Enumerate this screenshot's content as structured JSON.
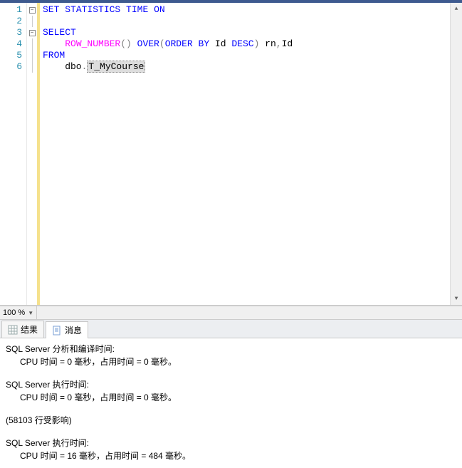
{
  "editor": {
    "lines": [
      {
        "n": 1,
        "fold": "minus",
        "tokens": [
          {
            "t": "SET",
            "c": "kw"
          },
          {
            "t": " ",
            "c": "txt"
          },
          {
            "t": "STATISTICS",
            "c": "kw"
          },
          {
            "t": " ",
            "c": "txt"
          },
          {
            "t": "TIME",
            "c": "kw"
          },
          {
            "t": " ",
            "c": "txt"
          },
          {
            "t": "ON",
            "c": "kw"
          }
        ]
      },
      {
        "n": 2,
        "fold": "line",
        "tokens": []
      },
      {
        "n": 3,
        "fold": "minus",
        "tokens": [
          {
            "t": "SELECT",
            "c": "kw"
          }
        ]
      },
      {
        "n": 4,
        "fold": "line",
        "tokens": [
          {
            "t": "    ",
            "c": "txt"
          },
          {
            "t": "ROW_NUMBER",
            "c": "fn"
          },
          {
            "t": "()",
            "c": "op"
          },
          {
            "t": " ",
            "c": "txt"
          },
          {
            "t": "OVER",
            "c": "kw"
          },
          {
            "t": "(",
            "c": "op"
          },
          {
            "t": "ORDER",
            "c": "kw"
          },
          {
            "t": " ",
            "c": "txt"
          },
          {
            "t": "BY",
            "c": "kw"
          },
          {
            "t": " Id ",
            "c": "txt"
          },
          {
            "t": "DESC",
            "c": "kw"
          },
          {
            "t": ")",
            "c": "op"
          },
          {
            "t": " rn",
            "c": "txt"
          },
          {
            "t": ",",
            "c": "op"
          },
          {
            "t": "Id",
            "c": "txt"
          }
        ]
      },
      {
        "n": 5,
        "fold": "line",
        "tokens": [
          {
            "t": "FROM",
            "c": "kw"
          }
        ]
      },
      {
        "n": 6,
        "fold": "line",
        "tokens": [
          {
            "t": "    dbo",
            "c": "txt"
          },
          {
            "t": ".",
            "c": "op"
          },
          {
            "t": "T_MyCourse",
            "c": "txt",
            "hl": true
          }
        ]
      }
    ]
  },
  "zoom": {
    "level": "100 %"
  },
  "tabs": {
    "results_label": "结果",
    "messages_label": "消息"
  },
  "messages": {
    "l1": "SQL Server 分析和编译时间:",
    "l2": "CPU 时间 = 0 毫秒，占用时间 = 0 毫秒。",
    "l3": "SQL Server 执行时间:",
    "l4": "CPU 时间 = 0 毫秒，占用时间 = 0 毫秒。",
    "l5": "(58103 行受影响)",
    "l6": "SQL Server 执行时间:",
    "l7": "CPU 时间 = 16 毫秒，占用时间 = 484 毫秒。"
  }
}
